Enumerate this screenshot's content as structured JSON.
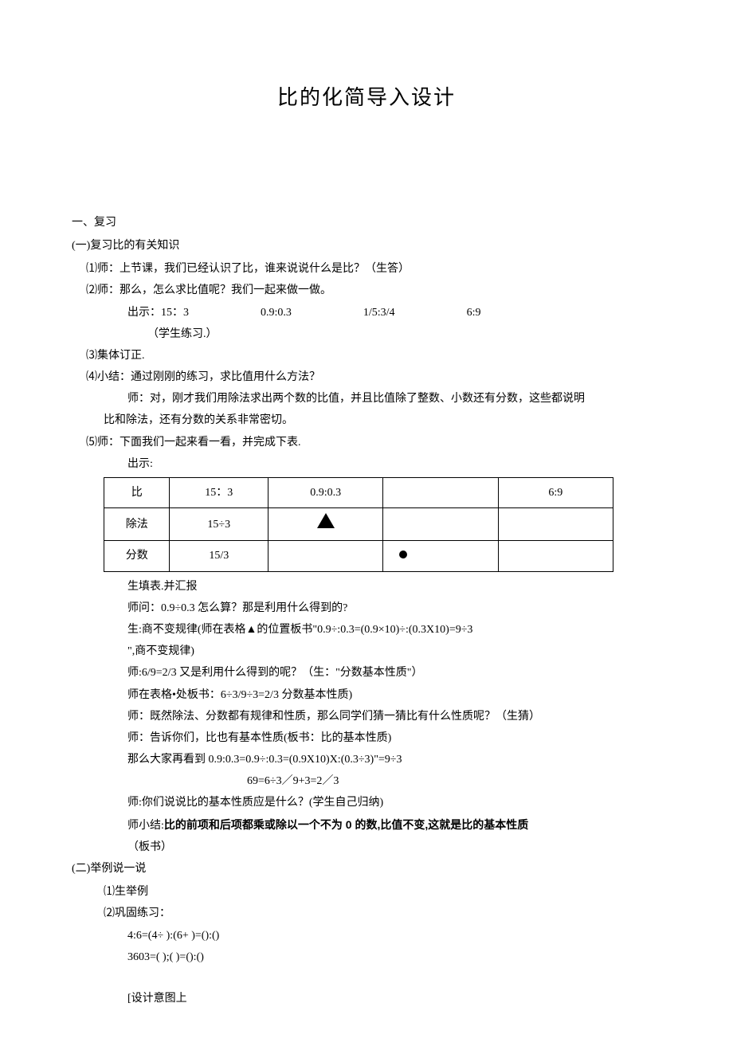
{
  "title": "比的化简导入设计",
  "s1": {
    "h": "一、复习",
    "p1h": "(一)复习比的有关知识",
    "l1": "⑴师：上节课，我们已经认识了比，谁来说说什么是比？（生答）",
    "l2": "⑵师：那么，怎么求比值呢？我们一起来做一做。",
    "l3a": "出示：15：3",
    "l3b": "0.9:0.3",
    "l3c": "1/5:3/4",
    "l3d": "6:9",
    "l4": "（学生练习.）",
    "l5": "⑶集体订正.",
    "l6": "⑷小结：通过刚刚的练习，求比值用什么方法？",
    "l7": "师：对，刚才我们用除法求出两个数的比值，并且比值除了整数、小数还有分数，这些都说明",
    "l8": "比和除法，还有分数的关系非常密切。",
    "l9": "⑸师：下面我们一起来看一看，并完成下表.",
    "l10": "出示:",
    "table": {
      "r1": {
        "c1": "比",
        "c2": "15：3",
        "c3": "0.9:0.3",
        "c4": "",
        "c5": "6:9"
      },
      "r2": {
        "c1": "除法",
        "c2": "15÷3",
        "c3": "",
        "c4": "",
        "c5": ""
      },
      "r3": {
        "c1": "分数",
        "c2": "15/3",
        "c3": "",
        "c4": "",
        "c5": ""
      }
    },
    "l11": "生填表.并汇报",
    "l12": "师问：0.9÷0.3 怎么算？那是利用什么得到的?",
    "l13": "生:商不变规律(师在表格▲的位置板书\"0.9÷:0.3=(0.9×10)÷:(0.3X10)=9÷3",
    "l14": "\",商不变规律)",
    "l15": "师:6/9=2/3 又是利用什么得到的呢？（生：\"分数基本性质\"）",
    "l16": "师在表格•处板书：6÷3/9÷3=2/3 分数基本性质)",
    "l17": "师：既然除法、分数都有规律和性质，那么同学们猜一猜比有什么性质呢？（生猜）",
    "l18": "师：告诉你们，比也有基本性质(板书：比的基本性质)",
    "l19": "那么大家再看到 0.9:0.3=0.9÷:0.3=(0.9X10)X:(0.3÷3)\"=9÷3",
    "l20": "69=6÷3／9+3=2／3",
    "l21": "师:你们说说比的基本性质应是什么？(学生自己归纳)",
    "l22a": "师小结:",
    "l22b": "比的前项和后项都乘或除以一个不为 0 的数,比值不变,这就是比的基本性质",
    "l23": "（板书）",
    "p2h": "(二)举例说一说",
    "l24": "⑴生举例",
    "l25": "⑵巩固练习：",
    "l26": "4:6=(4÷      ):(6+      )=():()",
    "l27": "3603=(           );(         )=():()",
    "l28": "[设计意图上"
  }
}
